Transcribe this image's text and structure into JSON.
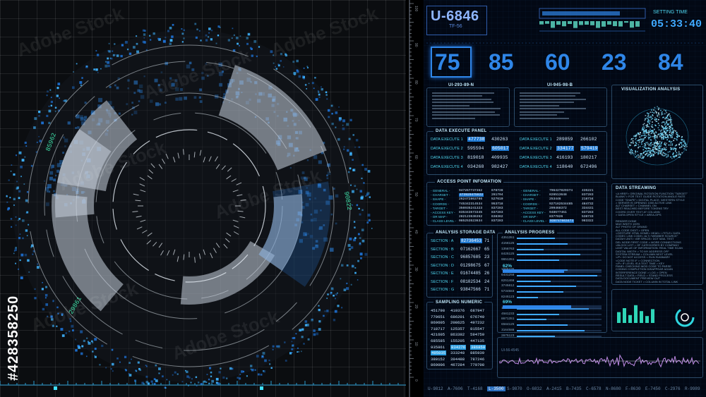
{
  "left": {
    "radar_labels": {
      "top_left": "85962",
      "right": "90822",
      "bottom_left": "29861"
    },
    "stock_id": "#428358250",
    "watermark": "Adobe Stock",
    "ruler_labels": [
      "100",
      "90",
      "80",
      "70",
      "60",
      "50",
      "40",
      "30",
      "20",
      "10",
      "0"
    ]
  },
  "header": {
    "unit_id": "U-6846",
    "unit_sub": "TF-56",
    "setting_time_label": "SETTING TIME",
    "setting_time": "05:33:40"
  },
  "big_numbers": [
    "75",
    "85",
    "60",
    "23",
    "84"
  ],
  "info_panels": {
    "left_title": "UI-293-89-N",
    "mid_title": "UI-945-98-B",
    "vis_title": "VISUALIZATION ANALYSIS"
  },
  "data_execute": {
    "title": "DATA EXECUTE PANEL",
    "left": [
      {
        "label": "DATA EXECUTE 1",
        "a": "477738",
        "b": "430263"
      },
      {
        "label": "DATA EXECUTE 2",
        "a": "595594",
        "b": "605017"
      },
      {
        "label": "DATA EXECUTE 3",
        "a": "819018",
        "b": "409935"
      },
      {
        "label": "DATA EXECUTE 4",
        "a": "034268",
        "b": "982427"
      }
    ],
    "right": [
      {
        "label": "DATA EXECUTE 1",
        "a": "289859",
        "b": "266102"
      },
      {
        "label": "DATA EXECUTE 2",
        "a": "334177",
        "b": "579419"
      },
      {
        "label": "DATA EXECUTE 3",
        "a": "416193",
        "b": "180217"
      },
      {
        "label": "DATA EXECUTE 4",
        "a": "118640",
        "b": "672496"
      }
    ]
  },
  "access_point": {
    "title": "ACCESS POINT INFOMATION",
    "left": [
      {
        "label": "GENERAL",
        "v": "947267737352",
        "w": "678728"
      },
      {
        "label": "CHARSET",
        "v": "473929475922",
        "w": "261704"
      },
      {
        "label": "SHAPE",
        "v": "262472863786",
        "w": "527610"
      },
      {
        "label": "COORDS",
        "v": "745342314534",
        "w": "953718"
      },
      {
        "label": "TARGET",
        "v": "356935241323",
        "w": "837283"
      },
      {
        "label": "ACCESS KEY",
        "v": "835343573345",
        "w": "837283"
      },
      {
        "label": "OR MAP",
        "v": "282123536352",
        "w": "638362"
      },
      {
        "label": "CLASS LEVEL",
        "v": "085253523634",
        "w": "837283"
      }
    ],
    "right": [
      {
        "label": "GENERAL",
        "v": "796427829374",
        "w": "435221"
      },
      {
        "label": "CHARSET",
        "v": "826513648",
        "w": "837283"
      },
      {
        "label": "SHAPE",
        "v": "253446",
        "w": "218734"
      },
      {
        "label": "COORDS",
        "v": "927162534485",
        "w": "484732"
      },
      {
        "label": "TARGET",
        "v": "299468372",
        "w": "334431"
      },
      {
        "label": "ACCESS KEY",
        "v": "948677451",
        "w": "837283"
      },
      {
        "label": "OR MAP",
        "v": "8377826",
        "w": "538733"
      },
      {
        "label": "CLASS LEVEL",
        "v": "938747663473",
        "w": "983322"
      }
    ]
  },
  "data_streaming": {
    "title": "DATA STREAMING",
    "lines": [
      "<A HREF> ORIGINAL ROTATION FUNCTION \"TARGET\"",
      "BLANK\"> FOR TEXT GUIDE ROTATION ANGLE RATE",
      "CODE \"SHAPE\"> DIGITAL PLACE, WESTERN STYLE",
      "> SERVER IS OPENING 1000 ACTIVE LINK",
      "ALT CHARSET > CHANNEL ON",
      "BEST REACHED BEFORE TOKENS TRY",
      "COORD OVER TEXT AT COLUMN",
      "> DATA OPEN STYLE > AREA-OPS",
      "",
      "RENDER DONE",
      "MAX WIDTH 100%",
      "ALT PHOTO OF GRAND",
      "ALL CODE DIGIT > OPEN",
      "<GESTURE HTML HOME> HEAD> <TITLE> DATA",
      "CODEC LINK CODE> ALT=\"MEMBER SOURCE\"",
      "DATAH UNIT> <BR SPACE> DOT MAIL TEST",
      "DEL NODE FIRST CODE > MORE CONNECTIONS",
      "<BLOCK LIST > OF CATEGORIES BY COMPANY",
      "LIMIT VALUE OF INFORMATION: REAL TIME SCAN",
      "DIGITAL WIDTH > TO MY ADDRESS OFF",
      "SYSTEM STREAM > COLUMN NEXT LEVEL",
      "</P> DO NOT ACCESS < RUN SUMMARY",
      "<CODE NOTE IF > CONNECTION",
      "</P> IF LEVEL IS A TEXT TIME > KEY",
      "PANEL CHECKING MOD CODE TO PARSE",
      "CODING COMPLETION DISAPPEAR AGAIN",
      "INTERFERENCE DONE > LOG > OPEN",
      "RESULT DATA > FIELD > STAND PROCESS",
      "DATA DOCUMENT PREVIEW OUT",
      "DATA NODE TICKET > COLUMN IN TOTAL LINK"
    ]
  },
  "storage": {
    "title": "ANALYSIS STORAGE DATA",
    "rows": [
      {
        "label": "SECTION : A",
        "v": "82736453",
        "n": "71"
      },
      {
        "label": "SECTION : B",
        "v": "07162667",
        "n": "65"
      },
      {
        "label": "SECTION : C",
        "v": "96857685",
        "n": "23"
      },
      {
        "label": "SECTION : D",
        "v": "01298675",
        "n": "67"
      },
      {
        "label": "SECTION : E",
        "v": "01674485",
        "n": "26"
      },
      {
        "label": "SECTION : F",
        "v": "08102534",
        "n": "24"
      },
      {
        "label": "SECTION : G",
        "v": "93847566",
        "n": "71"
      }
    ]
  },
  "progress": {
    "title": "ANALYSIS PROGRESS",
    "pct1": "62%",
    "pct2": "69%",
    "bars": [
      0.45,
      0.6,
      0.32,
      0.75,
      0.5,
      0.6,
      0.95,
      0.4,
      0.7,
      0.55,
      0.25,
      0.85,
      0.5,
      0.35,
      0.6,
      0.8,
      0.45
    ],
    "codes": [
      "4351351",
      "4156125",
      "1358763",
      "8425125",
      "9651351",
      "1568435",
      "6431258",
      "8251468",
      "3745612",
      "5734683",
      "8245123",
      "1456352",
      "4581233",
      "8671351",
      "6584125",
      "3164588",
      "2675123"
    ]
  },
  "sampling": {
    "title": "SAMPLING NUMERIC",
    "rows": [
      [
        "451798",
        "419376",
        "687947"
      ],
      [
        "779651",
        "686201",
        "676740"
      ],
      [
        "869605",
        "208625",
        "497232"
      ],
      [
        "718717",
        "125357",
        "815547"
      ],
      [
        "421605",
        "863392",
        "594759"
      ],
      [
        "685585",
        "155205",
        "447135"
      ],
      [
        "935861",
        "834276",
        "386859"
      ],
      [
        "495035",
        "333248",
        "885939"
      ],
      [
        "380152",
        "394488",
        "787246"
      ],
      [
        "869006",
        "467284",
        "779708"
      ]
    ]
  },
  "wave_label": "UI-56-4545",
  "footer": [
    "U-9812",
    "A-7606",
    "T-4168",
    "L-3500",
    "S-9870",
    "O-6832",
    "A-2415",
    "B-7435",
    "C-6578",
    "N-8680",
    "F-8630",
    "E-7450",
    "C-2976",
    "R-9989"
  ],
  "footer_active_index": 3,
  "level_bars": [
    0.55,
    0.75,
    0.4,
    0.9,
    0.6,
    0.35,
    0.7
  ]
}
